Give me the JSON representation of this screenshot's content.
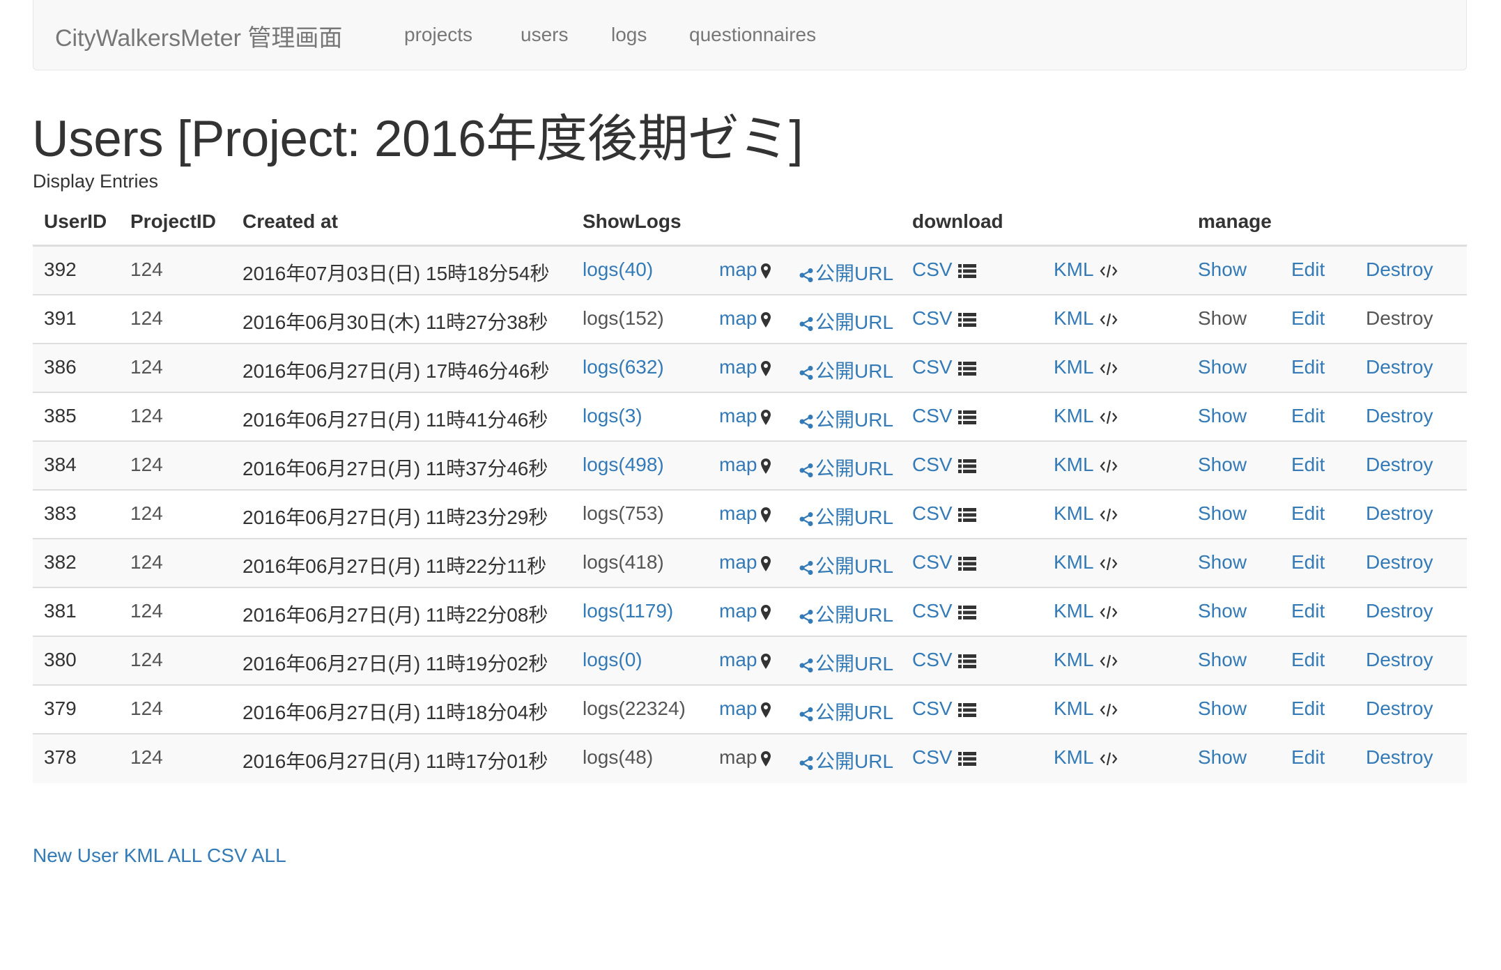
{
  "nav": {
    "brand": "CityWalkersMeter 管理画面",
    "links": [
      "projects",
      "users",
      "logs",
      "questionnaires"
    ]
  },
  "page": {
    "title": "Users [Project: 2016年度後期ゼミ]",
    "display_entries": "Display Entries"
  },
  "table": {
    "headers": {
      "user_id": "UserID",
      "project_id": "ProjectID",
      "created_at": "Created at",
      "show_logs": "ShowLogs",
      "download": "download",
      "manage": "manage"
    },
    "link_labels": {
      "map": "map",
      "public_url": "公開URL",
      "csv": "CSV",
      "kml": "KML",
      "show": "Show",
      "edit": "Edit",
      "destroy": "Destroy"
    },
    "rows": [
      {
        "user_id": "392",
        "project_id": "124",
        "created_at": "2016年07月03日(日) 15時18分54秒",
        "logs": "logs(40)",
        "logs_link": true,
        "map_link": true,
        "show_link": true,
        "destroy_link": true
      },
      {
        "user_id": "391",
        "project_id": "124",
        "created_at": "2016年06月30日(木) 11時27分38秒",
        "logs": "logs(152)",
        "logs_link": false,
        "map_link": true,
        "show_link": false,
        "destroy_link": false
      },
      {
        "user_id": "386",
        "project_id": "124",
        "created_at": "2016年06月27日(月) 17時46分46秒",
        "logs": "logs(632)",
        "logs_link": true,
        "map_link": true,
        "show_link": true,
        "destroy_link": true
      },
      {
        "user_id": "385",
        "project_id": "124",
        "created_at": "2016年06月27日(月) 11時41分46秒",
        "logs": "logs(3)",
        "logs_link": true,
        "map_link": true,
        "show_link": true,
        "destroy_link": true
      },
      {
        "user_id": "384",
        "project_id": "124",
        "created_at": "2016年06月27日(月) 11時37分46秒",
        "logs": "logs(498)",
        "logs_link": true,
        "map_link": true,
        "show_link": true,
        "destroy_link": true
      },
      {
        "user_id": "383",
        "project_id": "124",
        "created_at": "2016年06月27日(月) 11時23分29秒",
        "logs": "logs(753)",
        "logs_link": false,
        "map_link": true,
        "show_link": true,
        "destroy_link": true
      },
      {
        "user_id": "382",
        "project_id": "124",
        "created_at": "2016年06月27日(月) 11時22分11秒",
        "logs": "logs(418)",
        "logs_link": false,
        "map_link": true,
        "show_link": true,
        "destroy_link": true
      },
      {
        "user_id": "381",
        "project_id": "124",
        "created_at": "2016年06月27日(月) 11時22分08秒",
        "logs": "logs(1179)",
        "logs_link": true,
        "map_link": true,
        "show_link": true,
        "destroy_link": true
      },
      {
        "user_id": "380",
        "project_id": "124",
        "created_at": "2016年06月27日(月) 11時19分02秒",
        "logs": "logs(0)",
        "logs_link": true,
        "map_link": true,
        "show_link": true,
        "destroy_link": true
      },
      {
        "user_id": "379",
        "project_id": "124",
        "created_at": "2016年06月27日(月) 11時18分04秒",
        "logs": "logs(22324)",
        "logs_link": false,
        "map_link": true,
        "show_link": true,
        "destroy_link": true
      },
      {
        "user_id": "378",
        "project_id": "124",
        "created_at": "2016年06月27日(月) 11時17分01秒",
        "logs": "logs(48)",
        "logs_link": false,
        "map_link": false,
        "show_link": true,
        "destroy_link": true
      }
    ]
  },
  "footer": {
    "new_user": "New User",
    "kml_all": "KML ALL",
    "csv_all": "CSV ALL"
  },
  "colors": {
    "link": "#337ab7",
    "muted": "#555555",
    "navbar_bg": "#f8f8f8"
  },
  "icons": {
    "map": "map-marker-icon",
    "public_url": "share-icon",
    "csv": "list-icon",
    "kml": "code-icon"
  }
}
